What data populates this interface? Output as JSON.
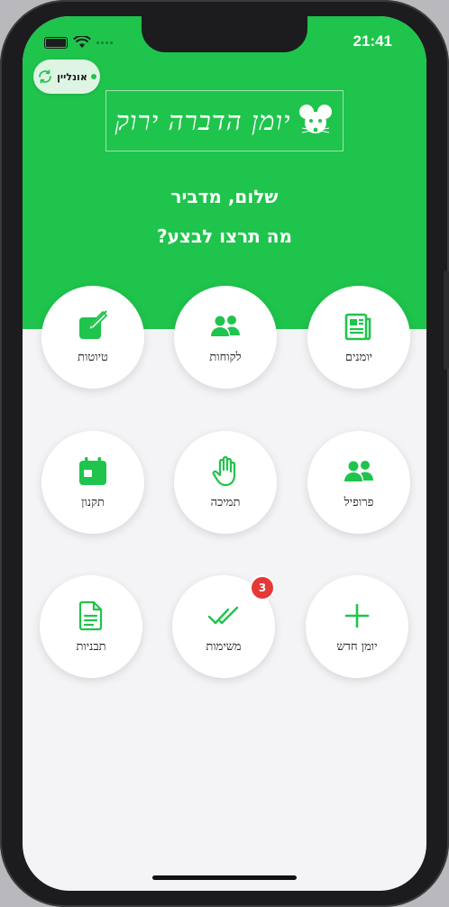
{
  "status": {
    "time": "21:41"
  },
  "online": {
    "label": "אונליין"
  },
  "logo": {
    "text": "יומן הדברה ירוק"
  },
  "greeting": {
    "hello": "שלום, מדביר",
    "question": "מה תרצו לבצע?"
  },
  "tiles": [
    {
      "label": "יומנים",
      "icon": "journal-icon"
    },
    {
      "label": "לקוחות",
      "icon": "users-icon"
    },
    {
      "label": "טיוטות",
      "icon": "edit-icon"
    },
    {
      "label": "פרופיל",
      "icon": "user-group-icon"
    },
    {
      "label": "תמיכה",
      "icon": "hand-icon"
    },
    {
      "label": "תקנון",
      "icon": "calendar-icon"
    },
    {
      "label": "יומן חדש",
      "icon": "plus-icon"
    },
    {
      "label": "משימות",
      "icon": "double-check-icon",
      "badge": "3"
    },
    {
      "label": "תבניות",
      "icon": "document-icon"
    }
  ],
  "colors": {
    "brand": "#1fc44c",
    "badge": "#e53935",
    "background": "#f4f4f6"
  }
}
